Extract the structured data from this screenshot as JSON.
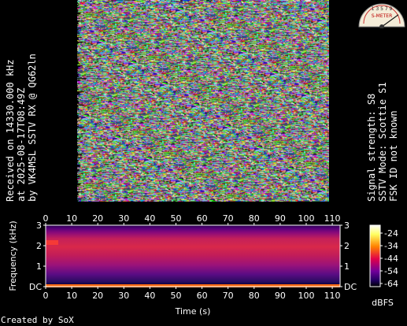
{
  "header_left": {
    "line1": "Received on  14330.000 kHz",
    "line2": "at 2025-08-17T08:49Z",
    "line3": "by VK4MSL SSTV RX @ QG62ln"
  },
  "header_right": {
    "line1": "Signal strength: S8",
    "line2": "SSTV Mode: Scottie S1",
    "line3": "FSK ID not known"
  },
  "meter": {
    "scale": "1 3 5 7 9",
    "label": "S-METER",
    "reading": "S8",
    "level": 0.8
  },
  "spectrogram": {
    "x_ticks": [
      "0",
      "10",
      "20",
      "30",
      "40",
      "50",
      "60",
      "70",
      "80",
      "90",
      "100",
      "110"
    ],
    "y_ticks": [
      "3",
      "2",
      "1",
      "DC"
    ],
    "x_label": "Time (s)",
    "y_label": "Frequency (kHz)",
    "colorbar_ticks": [
      "-24",
      "-34",
      "-44",
      "-54",
      "-64"
    ],
    "colorbar_label": "dBFS"
  },
  "footer": {
    "created_by": "Created by SoX"
  },
  "colors": {
    "bg": "#000000",
    "spectrum_high": "#ff1a1a",
    "spectrum_low": "#4d006b"
  }
}
